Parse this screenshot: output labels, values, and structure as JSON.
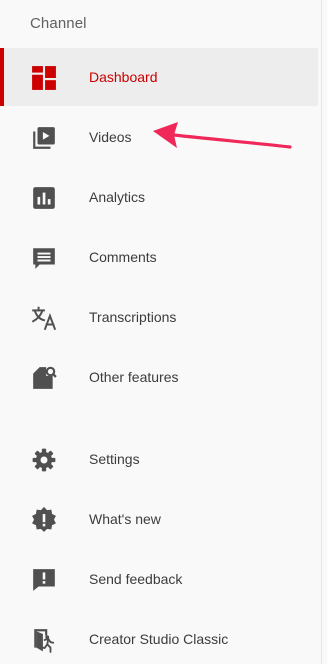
{
  "sidebar": {
    "section_title": "Channel",
    "items": [
      {
        "label": "Dashboard",
        "icon": "dashboard-icon",
        "active": true
      },
      {
        "label": "Videos",
        "icon": "videos-icon"
      },
      {
        "label": "Analytics",
        "icon": "analytics-icon"
      },
      {
        "label": "Comments",
        "icon": "comments-icon"
      },
      {
        "label": "Transcriptions",
        "icon": "transcriptions-icon"
      },
      {
        "label": "Other features",
        "icon": "other-features-icon"
      }
    ],
    "footer_items": [
      {
        "label": "Settings",
        "icon": "gear-icon"
      },
      {
        "label": "What's new",
        "icon": "whats-new-icon"
      },
      {
        "label": "Send feedback",
        "icon": "feedback-icon"
      },
      {
        "label": "Creator Studio Classic",
        "icon": "creator-studio-classic-icon"
      }
    ]
  },
  "annotation": {
    "arrow_color": "#f0285a"
  },
  "colors": {
    "accent": "#cc0000",
    "icon": "#505050",
    "text": "#3c3c3c",
    "section_title": "#606060",
    "active_bg": "#ededed",
    "background": "#f9f9f9"
  }
}
